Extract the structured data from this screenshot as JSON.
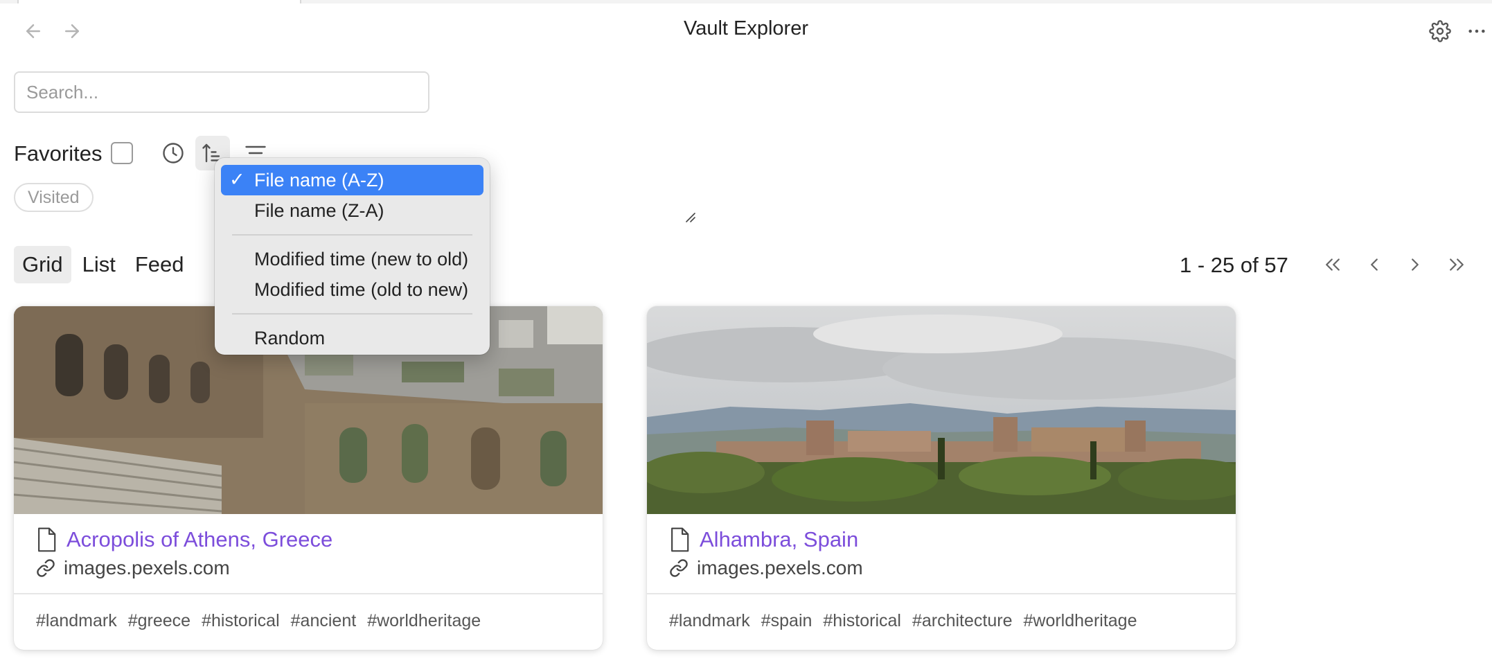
{
  "window": {
    "title": "Vault Explorer",
    "back_icon": "arrow-left-icon",
    "forward_icon": "arrow-right-icon",
    "settings_icon": "gear-icon",
    "more_icon": "more-horizontal-icon"
  },
  "search": {
    "placeholder": "Search...",
    "value": ""
  },
  "filters": {
    "favorites_label": "Favorites",
    "favorites_checked": false,
    "tools": [
      "clock-icon",
      "sort-ascending-icon",
      "filter-lines-icon"
    ],
    "chips": [
      "Visited"
    ]
  },
  "sort_menu": {
    "groups": [
      [
        {
          "label": "File name (A-Z)",
          "selected": true,
          "check": "✓"
        },
        {
          "label": "File name (Z-A)",
          "selected": false
        }
      ],
      [
        {
          "label": "Modified time (new to old)",
          "selected": false
        },
        {
          "label": "Modified time (old to new)",
          "selected": false
        }
      ],
      [
        {
          "label": "Random",
          "selected": false
        }
      ]
    ]
  },
  "views": {
    "tabs": [
      {
        "label": "Grid",
        "active": true
      },
      {
        "label": "List",
        "active": false
      },
      {
        "label": "Feed",
        "active": false
      }
    ]
  },
  "pagination": {
    "text": "1 - 25 of 57",
    "buttons": [
      "first-page-icon",
      "previous-page-icon",
      "next-page-icon",
      "last-page-icon"
    ]
  },
  "cards": [
    {
      "title": "Acropolis of Athens, Greece",
      "url": "images.pexels.com",
      "tags": [
        "#landmark",
        "#greece",
        "#historical",
        "#ancient",
        "#worldheritage"
      ]
    },
    {
      "title": "Alhambra, Spain",
      "url": "images.pexels.com",
      "tags": [
        "#landmark",
        "#spain",
        "#historical",
        "#architecture",
        "#worldheritage"
      ]
    }
  ],
  "colors": {
    "accent_link": "#7c4ddb",
    "menu_selected": "#3b82f6",
    "active_tab_bg": "#ececec"
  }
}
